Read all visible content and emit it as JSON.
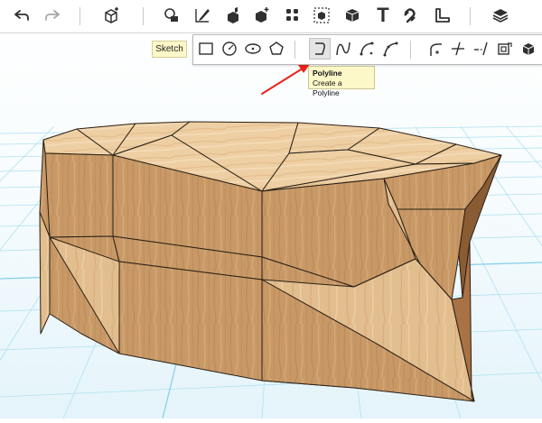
{
  "toolbar": {
    "tools": [
      {
        "icon": "undo-icon"
      },
      {
        "icon": "redo-icon"
      },
      {
        "icon": "primitives-icon"
      },
      {
        "icon": "shapes-icon"
      },
      {
        "icon": "sketch-tool-icon"
      },
      {
        "icon": "construct-icon"
      },
      {
        "icon": "modify-icon"
      },
      {
        "icon": "pattern-icon"
      },
      {
        "icon": "grouping-icon"
      },
      {
        "icon": "combine-icon"
      },
      {
        "icon": "text-tool-icon",
        "glyph": "T"
      },
      {
        "icon": "snap-magnet-icon"
      },
      {
        "icon": "measure-icon"
      },
      {
        "icon": "material-layers-icon"
      }
    ]
  },
  "sketch_menu": {
    "label": "Sketch",
    "tools": [
      {
        "icon": "rectangle-icon"
      },
      {
        "icon": "circle-icon"
      },
      {
        "icon": "ellipse-icon"
      },
      {
        "icon": "polygon-icon"
      },
      {
        "icon": "polyline-icon",
        "active": true
      },
      {
        "icon": "spline-icon"
      },
      {
        "icon": "two-point-arc-icon"
      },
      {
        "icon": "three-point-arc-icon"
      },
      {
        "icon": "fillet-icon"
      },
      {
        "icon": "trim-icon"
      },
      {
        "icon": "extend-icon"
      },
      {
        "icon": "offset-icon"
      },
      {
        "icon": "project-icon"
      }
    ]
  },
  "tooltip": {
    "title": "Polyline",
    "description": "Create a Polyline"
  },
  "colors": {
    "grid_background": "#e8f6fb",
    "grid_line": "#a9def0",
    "wood_light": "#e8c79c",
    "wood_dark": "#c8925e",
    "edge": "#2a2016",
    "annotation_arrow": "#e8231a",
    "tooltip_bg": "#fdf8c8",
    "icon": "#303030"
  }
}
